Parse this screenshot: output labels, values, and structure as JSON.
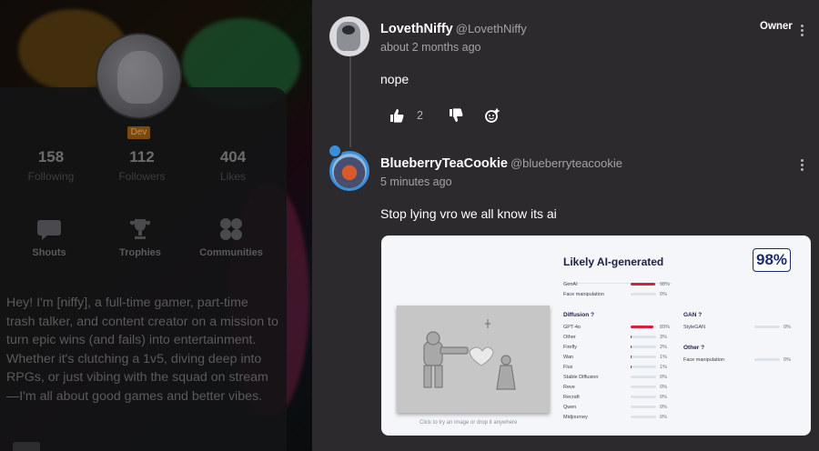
{
  "profile": {
    "badge": "Dev",
    "stats": [
      {
        "value": "158",
        "label": "Following"
      },
      {
        "value": "112",
        "label": "Followers"
      },
      {
        "value": "404",
        "label": "Likes"
      }
    ],
    "tiles": [
      {
        "label": "Shouts",
        "icon": "speech-bubble-icon"
      },
      {
        "label": "Trophies",
        "icon": "trophy-icon"
      },
      {
        "label": "Communities",
        "icon": "grid-dots-icon"
      }
    ],
    "bio": "Hey! I'm [niffy], a full-time gamer, part-time trash talker, and content creator on a mission to turn epic wins (and fails) into entertainment. Whether it's clutching a 1v5, diving deep into RPGs, or just vibing with the squad on stream—I'm all about good games and better vibes."
  },
  "comments": [
    {
      "name": "LovethNiffy",
      "handle": "@LovethNiffy",
      "time": "about 2 months ago",
      "text": "nope",
      "owner_label": "Owner",
      "likes": "2"
    },
    {
      "name": "BlueberryTeaCookie",
      "handle": "@blueberryteacookie",
      "time": "5 minutes ago",
      "text": "Stop lying vro we all know its ai",
      "attachment": {
        "title": "Likely AI-generated",
        "score": "98%",
        "caption": "Click to try an image or drop it anywhere",
        "top_rows": [
          {
            "label": "GenAI",
            "value": 98,
            "pct": "98%"
          },
          {
            "label": "Face manipulation",
            "value": 0,
            "pct": "0%"
          }
        ],
        "diffusion_label": "Diffusion",
        "diffusion_rows": [
          {
            "label": "GPT-4o",
            "value": 89,
            "pct": "89%"
          },
          {
            "label": "Other",
            "value": 3,
            "pct": "3%"
          },
          {
            "label": "Firefly",
            "value": 2,
            "pct": "2%"
          },
          {
            "label": "Wan",
            "value": 1,
            "pct": "1%"
          },
          {
            "label": "Flux",
            "value": 1,
            "pct": "1%"
          },
          {
            "label": "Stable Diffusion",
            "value": 0,
            "pct": "0%"
          },
          {
            "label": "Reve",
            "value": 0,
            "pct": "0%"
          },
          {
            "label": "Recraft",
            "value": 0,
            "pct": "0%"
          },
          {
            "label": "Qwen",
            "value": 0,
            "pct": "0%"
          },
          {
            "label": "Midjourney",
            "value": 0,
            "pct": "0%"
          }
        ],
        "gan_label": "GAN",
        "gan_rows": [
          {
            "label": "StyleGAN",
            "value": 0,
            "pct": "0%"
          }
        ],
        "other_label": "Other",
        "other_rows": [
          {
            "label": "Face manipulation",
            "value": 0,
            "pct": "0%"
          }
        ]
      }
    }
  ],
  "colors": {
    "pane_bg": "#2d2a2e",
    "accent_red": "#d0203a",
    "score_blue": "#1d2a6b"
  }
}
